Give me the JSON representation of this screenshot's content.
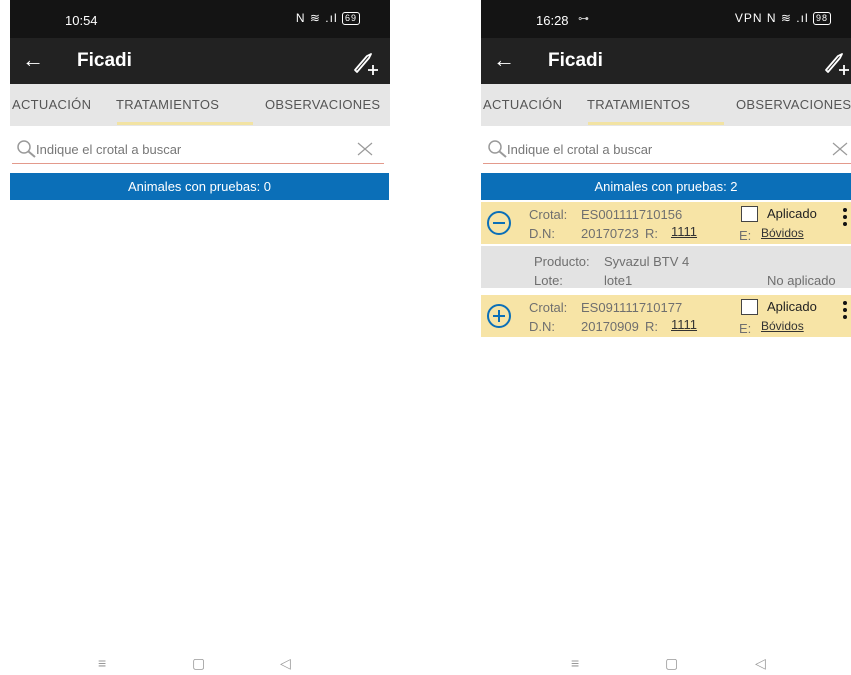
{
  "left": {
    "status": {
      "time": "10:54",
      "icons": "N ≋ .ıl",
      "battery": "69"
    },
    "appbar": {
      "back": "←",
      "title": "Ficadi",
      "add_icon": "add-treatment-icon"
    },
    "tabs": [
      "ACTUACIÓN",
      "TRATAMIENTOS",
      "OBSERVACIONES"
    ],
    "search": {
      "placeholder": "Indique el crotal a buscar"
    },
    "banner": "Animales con pruebas: 0"
  },
  "right": {
    "status": {
      "time": "16:28",
      "extra": "⊶",
      "icons": "VPN N ≋ .ıl",
      "battery": "98"
    },
    "appbar": {
      "back": "←",
      "title": "Ficadi",
      "add_icon": "add-treatment-icon"
    },
    "tabs": [
      "ACTUACIÓN",
      "TRATAMIENTOS",
      "OBSERVACIONES"
    ],
    "search": {
      "placeholder": "Indique el crotal a buscar"
    },
    "banner": "Animales con pruebas: 2",
    "animals": [
      {
        "expanded": true,
        "crotal_label": "Crotal:",
        "crotal": "ES001111710156",
        "dn_label": "D.N:",
        "dn": "20170723",
        "r_label": "R:",
        "r": "1111",
        "e_label": "E:",
        "e": "Bóvidos",
        "check_label": "Aplicado",
        "detail": {
          "producto_label": "Producto:",
          "producto": "Syvazul BTV 4",
          "lote_label": "Lote:",
          "lote": "lote1",
          "status": "No aplicado"
        }
      },
      {
        "expanded": false,
        "crotal_label": "Crotal:",
        "crotal": "ES091111710177",
        "dn_label": "D.N:",
        "dn": "20170909",
        "r_label": "R:",
        "r": "1111",
        "e_label": "E:",
        "e": "Bóvidos",
        "check_label": "Aplicado"
      }
    ]
  },
  "navbar": {
    "menu": "≡",
    "home": "▢",
    "back": "◁"
  },
  "colors": {
    "accent_blue": "#0b6fb8",
    "row_yellow": "#f7e4a6",
    "appbar": "#222222",
    "tab_indicator": "#f2e3a3"
  }
}
